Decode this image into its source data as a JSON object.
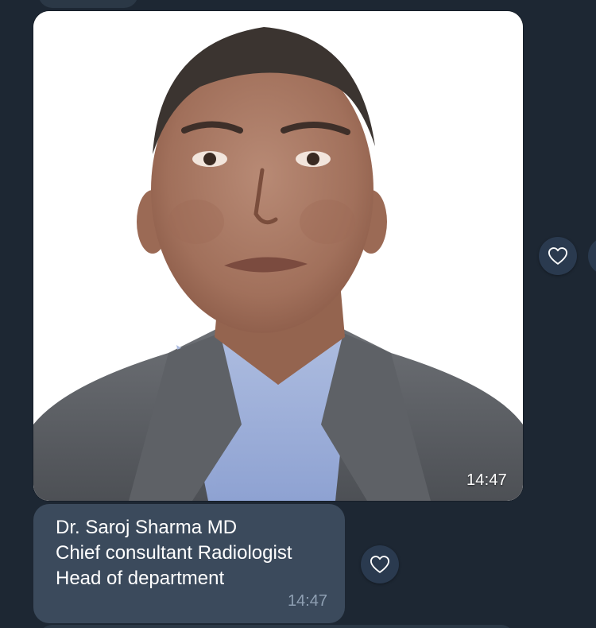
{
  "photo_message": {
    "image_description_icon": "portrait-photo",
    "time": "14:47"
  },
  "text_message": {
    "lines": [
      "Dr. Saroj Sharma MD",
      "Chief consultant Radiologist",
      "Head of department"
    ],
    "time": "14:47"
  },
  "reactions": {
    "icon": "heart-icon"
  },
  "colors": {
    "background": "#1d2733",
    "bubble": "#3b4a5c",
    "reaction_button": "#2a3a4f",
    "time_muted": "#8fa0b3"
  }
}
